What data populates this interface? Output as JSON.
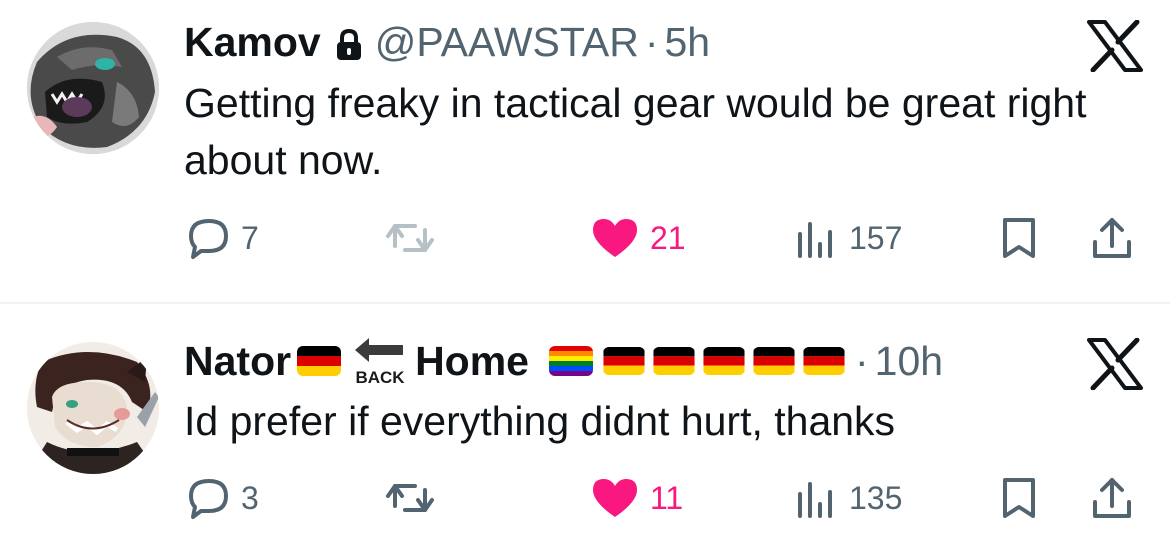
{
  "tweets": [
    {
      "display_name": "Kamov",
      "handle": "@PAAWSTAR",
      "separator": "·",
      "time": "5h",
      "text": "Getting freaky in tactical gear would be great right about now.",
      "avatar_icon": "avatar-wolf-grey",
      "protected_icon": "lock-icon",
      "replies": "7",
      "retweets": "",
      "likes": "21",
      "liked": true,
      "views": "157"
    },
    {
      "display_name": "Nator",
      "name_emoji": [
        "flag-germany",
        "back-arrow",
        "flag-rainbow",
        "flag-germany",
        "flag-germany",
        "flag-germany",
        "flag-germany",
        "flag-germany"
      ],
      "back_label": "BACK",
      "home_label": "Home",
      "separator": "·",
      "time": "10h",
      "text": "Id prefer if everything didnt hurt, thanks",
      "avatar_icon": "avatar-brown-haired",
      "replies": "3",
      "retweets": "",
      "likes": "11",
      "liked": true,
      "views": "135"
    }
  ],
  "colors": {
    "text_primary": "#0f1419",
    "text_secondary": "#536471",
    "like_pink": "#f91880",
    "divider": "#eff3f4"
  }
}
